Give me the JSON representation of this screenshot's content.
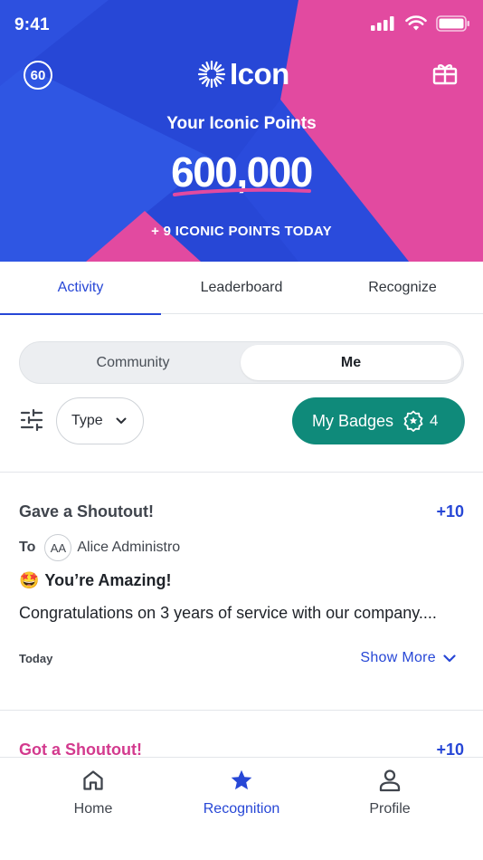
{
  "status_bar": {
    "time": "9:41"
  },
  "header": {
    "points_badge": "60",
    "logo_text": "Icon",
    "title": "Your Iconic Points",
    "points": "600,000",
    "today": "+ 9 ICONIC POINTS TODAY",
    "colors": {
      "blue": "#2747d6",
      "pink": "#e24aa0",
      "deep_blue": "#1f3ec9"
    }
  },
  "tabs": [
    {
      "label": "Activity",
      "active": true
    },
    {
      "label": "Leaderboard",
      "active": false
    },
    {
      "label": "Recognize",
      "active": false
    }
  ],
  "segment": {
    "left": "Community",
    "right": "Me",
    "selected": "Me"
  },
  "filters": {
    "type_label": "Type",
    "badges_label": "My Badges",
    "badges_count": "4",
    "badges_color": "#0f8a7a"
  },
  "feed": [
    {
      "title": "Gave a Shoutout!",
      "points": "+10",
      "to_label": "To",
      "avatar_initials": "AA",
      "recipient": "Alice Administro",
      "badge_emoji": "🤩",
      "badge_name": "You’re Amazing!",
      "message": "Congratulations on 3 years of service with our company....",
      "date": "Today",
      "show_more": "Show More"
    },
    {
      "title": "Got a Shoutout!",
      "points": "+10"
    }
  ],
  "bottom_nav": [
    {
      "label": "Home",
      "icon": "home-icon",
      "active": false
    },
    {
      "label": "Recognition",
      "icon": "star-icon",
      "active": true
    },
    {
      "label": "Profile",
      "icon": "profile-icon",
      "active": false
    }
  ]
}
